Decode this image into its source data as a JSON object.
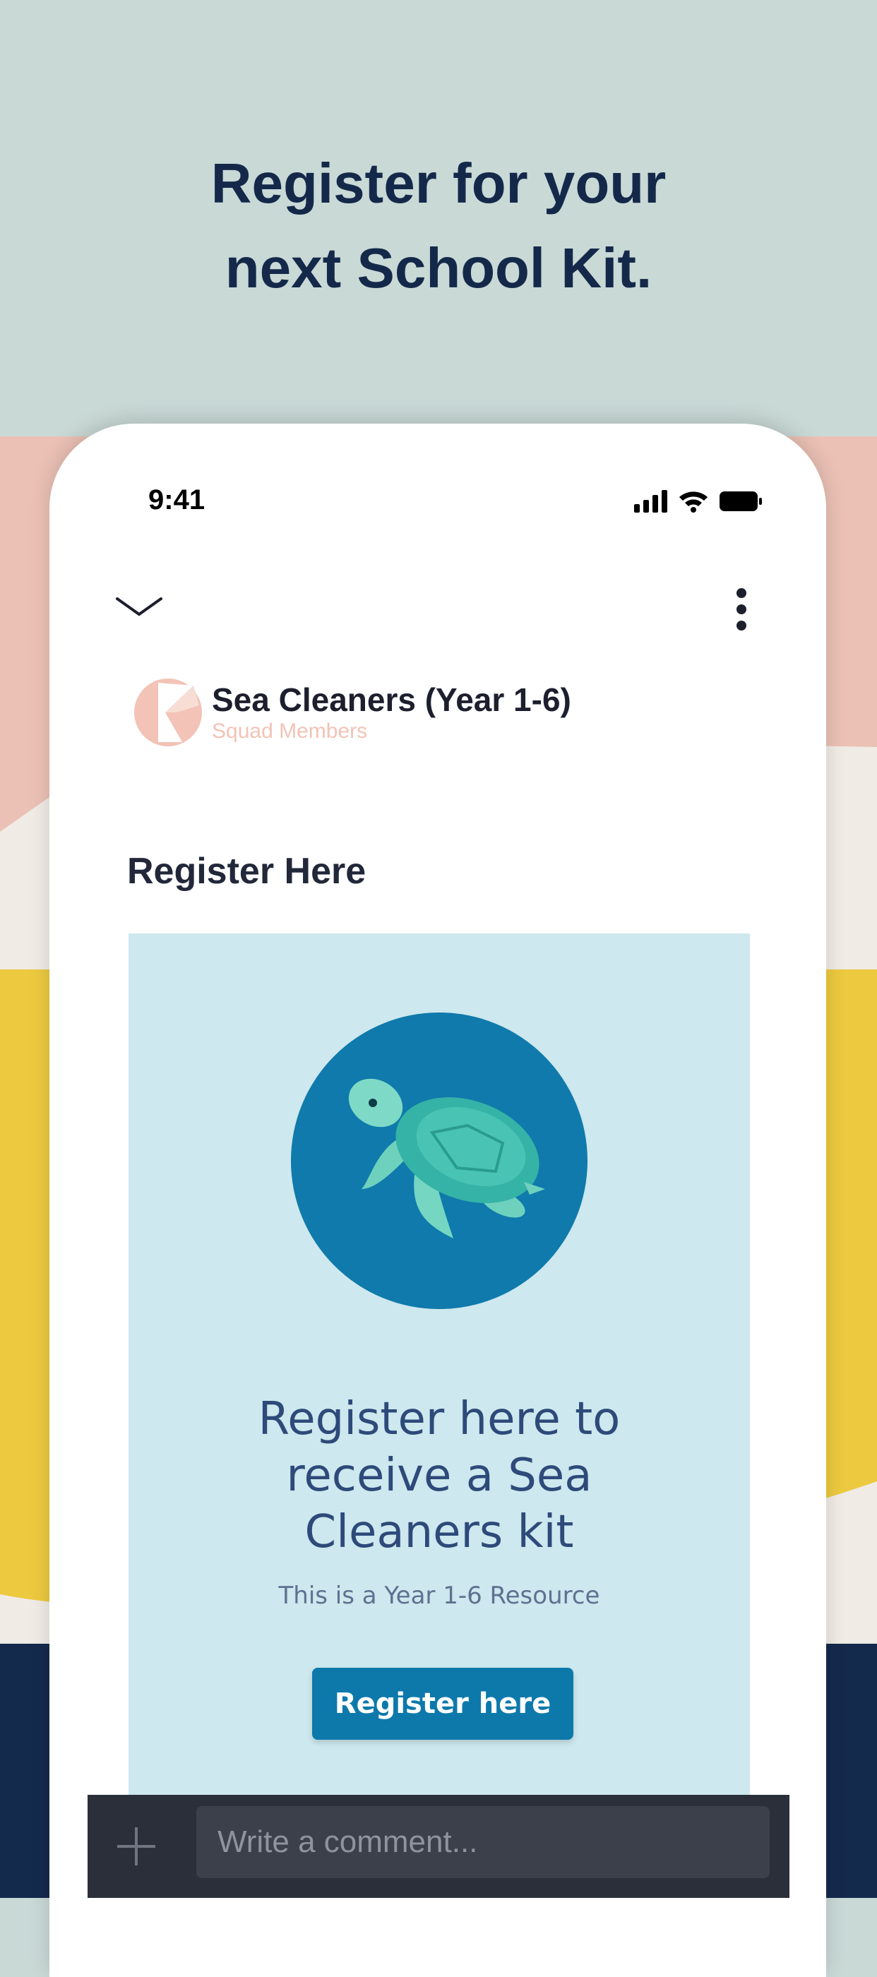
{
  "promo": {
    "headline_line1": "Register for your",
    "headline_line2": "next School Kit."
  },
  "status_bar": {
    "time": "9:41"
  },
  "group": {
    "name": "Sea Cleaners (Year 1-6)",
    "subtitle": "Squad Members"
  },
  "post": {
    "section_title": "Register Here",
    "card_title_line1": "Register here to",
    "card_title_line2": "receive a Sea",
    "card_title_line3": "Cleaners kit",
    "card_subtitle": "This is a Year 1-6 Resource",
    "register_button_label": "Register here"
  },
  "comment_bar": {
    "placeholder": "Write a comment..."
  },
  "colors": {
    "headline": "#14294a",
    "accent_blue": "#0d79ab",
    "card_bg": "#cde8ee",
    "group_sub": "#f2c3b6"
  },
  "icons": [
    "chevron-down-icon",
    "more-vertical-icon",
    "signal-icon",
    "wifi-icon",
    "battery-icon",
    "add-icon",
    "turtle-illustration"
  ]
}
